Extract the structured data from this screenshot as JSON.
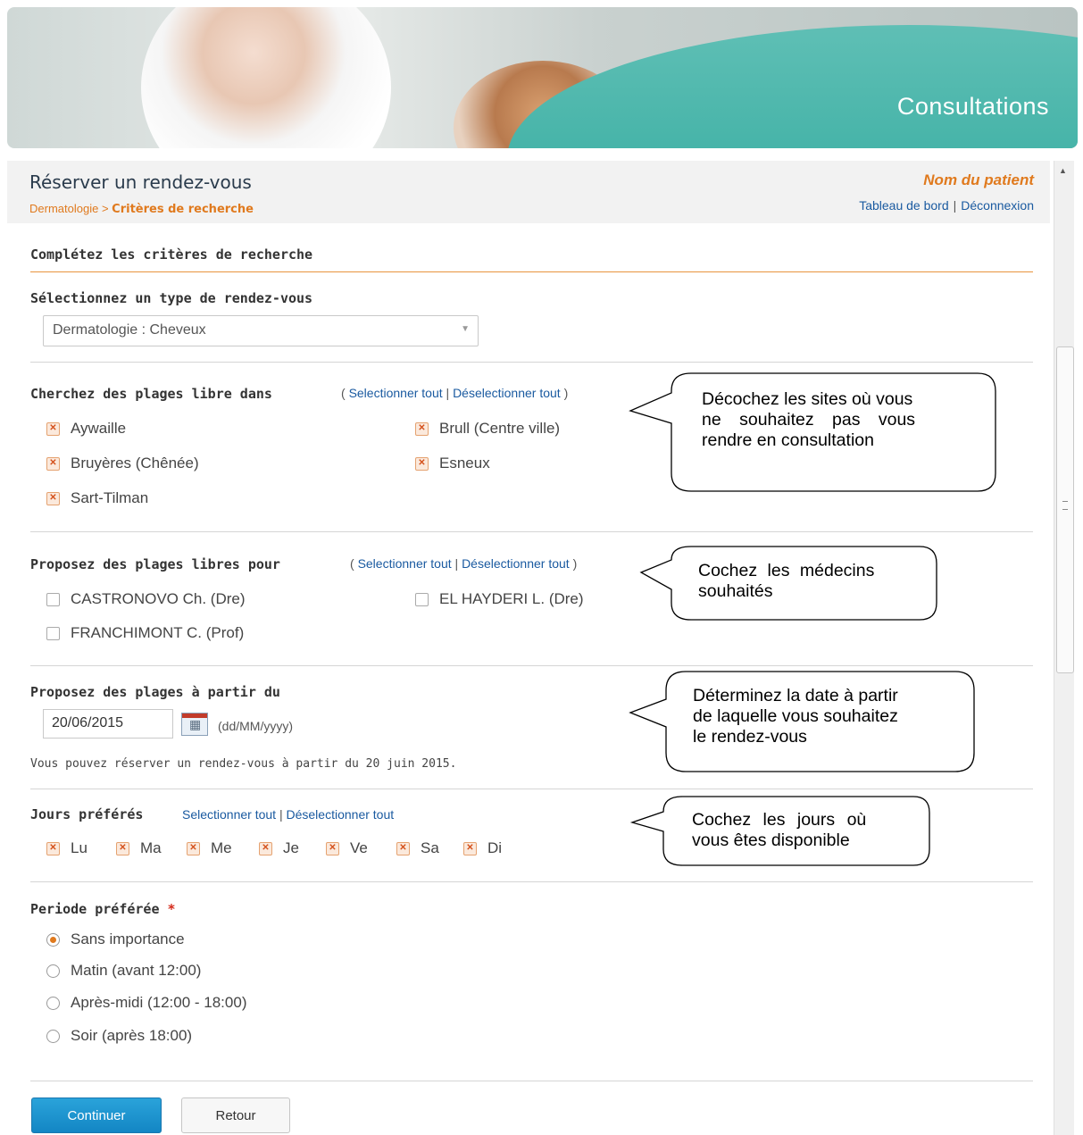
{
  "banner": {
    "title": "Consultations"
  },
  "header": {
    "page_title": "Réserver un rendez-vous",
    "breadcrumb_root": "Dermatologie",
    "breadcrumb_sep": ">",
    "breadcrumb_current": "Critères de recherche",
    "patient_name": "Nom du patient",
    "dashboard_link": "Tableau de bord",
    "logout_link": "Déconnexion",
    "link_sep": "|"
  },
  "form": {
    "intro": "Complétez les critères de recherche",
    "type": {
      "label": "Sélectionnez un type de rendez-vous",
      "value": "Dermatologie : Cheveux"
    },
    "sites": {
      "label": "Cherchez des plages libre dans",
      "select_all": "Selectionner tout",
      "deselect_all": "Déselectionner tout",
      "items": [
        {
          "label": "Aywaille",
          "checked": true
        },
        {
          "label": "Brull (Centre ville)",
          "checked": true
        },
        {
          "label": "Bruyères (Chênée)",
          "checked": true
        },
        {
          "label": "Esneux",
          "checked": true
        },
        {
          "label": "Sart-Tilman",
          "checked": true
        }
      ]
    },
    "doctors": {
      "label": "Proposez des plages libres pour",
      "select_all": "Selectionner tout",
      "deselect_all": "Déselectionner tout",
      "items": [
        {
          "label": "CASTRONOVO Ch. (Dre)",
          "checked": false
        },
        {
          "label": "EL HAYDERI L. (Dre)",
          "checked": false
        },
        {
          "label": "FRANCHIMONT C. (Prof)",
          "checked": false
        }
      ]
    },
    "date": {
      "label": "Proposez des plages à partir du",
      "value": "20/06/2015",
      "format": "(dd/MM/yyyy)",
      "note": "Vous pouvez réserver un rendez-vous à partir du 20 juin 2015."
    },
    "days": {
      "label": "Jours préférés",
      "select_all": "Selectionner tout",
      "deselect_all": "Déselectionner tout",
      "items": [
        {
          "label": "Lu",
          "checked": true
        },
        {
          "label": "Ma",
          "checked": true
        },
        {
          "label": "Me",
          "checked": true
        },
        {
          "label": "Je",
          "checked": true
        },
        {
          "label": "Ve",
          "checked": true
        },
        {
          "label": "Sa",
          "checked": true
        },
        {
          "label": "Di",
          "checked": true
        }
      ]
    },
    "period": {
      "label": "Periode préférée",
      "required_mark": "*",
      "options": [
        {
          "label": "Sans importance",
          "selected": true
        },
        {
          "label": "Matin (avant 12:00)",
          "selected": false
        },
        {
          "label": "Après-midi (12:00 - 18:00)",
          "selected": false
        },
        {
          "label": "Soir (après 18:00)",
          "selected": false
        }
      ]
    },
    "buttons": {
      "continue": "Continuer",
      "back": "Retour"
    }
  },
  "callouts": {
    "sites": [
      "Décochez les sites où vous",
      "ne souhaitez pas vous",
      "rendre en consultation"
    ],
    "doctors": [
      "Cochez les médecins",
      "souhaités"
    ],
    "date": [
      "Déterminez la date à partir",
      "de laquelle vous souhaitez",
      "le rendez-vous"
    ],
    "days": [
      "Cochez les jours où",
      "vous êtes disponible"
    ]
  },
  "colors": {
    "accent": "#e07a1e",
    "link": "#1a5aa0",
    "primary_button": "#1a8fcf",
    "banner_teal": "#2aa79a"
  }
}
